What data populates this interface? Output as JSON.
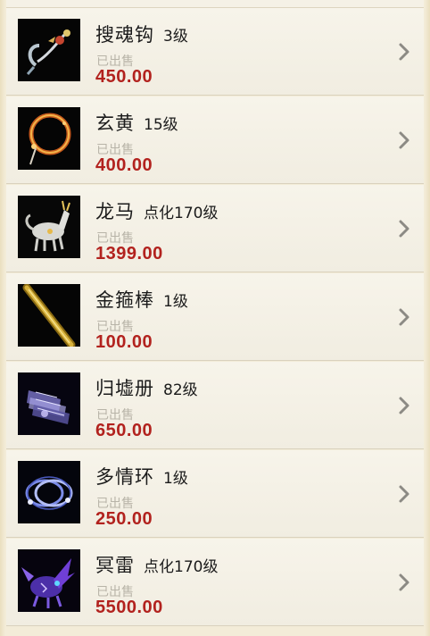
{
  "items": [
    {
      "name": "搜魂钩",
      "level": "3级",
      "status": "已出售",
      "price": "450.00",
      "image_icon": "hook-weapon-icon"
    },
    {
      "name": "玄黄",
      "level": "15级",
      "status": "已出售",
      "price": "400.00",
      "image_icon": "flame-ring-icon"
    },
    {
      "name": "龙马",
      "level": "点化170级",
      "status": "已出售",
      "price": "1399.00",
      "image_icon": "dragon-horse-icon"
    },
    {
      "name": "金箍棒",
      "level": "1级",
      "status": "已出售",
      "price": "100.00",
      "image_icon": "golden-staff-icon"
    },
    {
      "name": "归墟册",
      "level": "82级",
      "status": "已出售",
      "price": "650.00",
      "image_icon": "scroll-book-icon"
    },
    {
      "name": "多情环",
      "level": "1级",
      "status": "已出售",
      "price": "250.00",
      "image_icon": "twin-rings-icon"
    },
    {
      "name": "冥雷",
      "level": "点化170级",
      "status": "已出售",
      "price": "5500.00",
      "image_icon": "thunder-beast-icon"
    }
  ],
  "colors": {
    "price": "#b2221e",
    "status": "#b8b4a8",
    "background": "#f3ecd8"
  },
  "icons": {
    "row_arrow": "chevron-right-icon"
  }
}
